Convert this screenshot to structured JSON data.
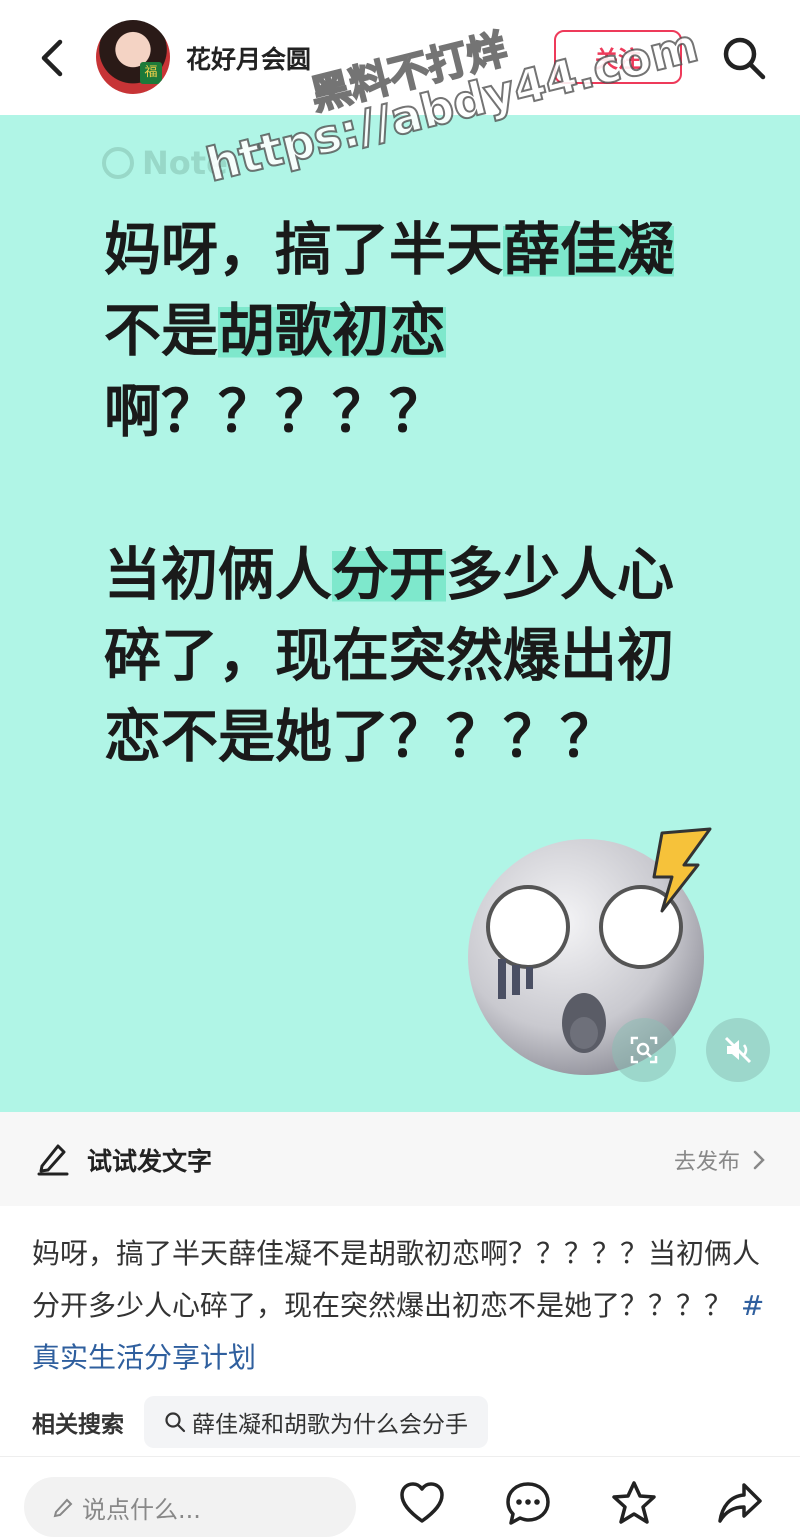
{
  "header": {
    "username": "花好月会圆",
    "follow_label": "关注"
  },
  "watermark": {
    "line1": "黑料不打烊",
    "line2": "https://abdy44.com"
  },
  "card": {
    "logo_text": "Note",
    "headline1": {
      "before": "妈呀，搞了半天",
      "hl1": "薛佳凝",
      "middle": "不是",
      "hl2": "胡歌初恋",
      "after": "啊？？？？？"
    },
    "headline2": {
      "before": "当初俩人",
      "hl": "分开",
      "after": "多少人心碎了，现在突然爆出初恋不是她了？？？？"
    },
    "background_color": "#b0f5e6",
    "highlight_color": "#7ee8cc"
  },
  "try_bar": {
    "label": "试试发文字",
    "publish_label": "去发布"
  },
  "post": {
    "text": "妈呀，搞了半天薛佳凝不是胡歌初恋啊？？？？？当初俩人分开多少人心碎了，现在突然爆出初恋不是她了？？？？ ",
    "hashtag": "#真实生活分享计划"
  },
  "related": {
    "label": "相关搜索",
    "query": "薛佳凝和胡歌为什么会分手"
  },
  "bottom_bar": {
    "comment_placeholder": "说点什么..."
  },
  "icons": [
    "back-arrow-icon",
    "search-icon",
    "scan-icon",
    "mute-icon",
    "pen-icon",
    "chevron-right-icon",
    "heart-icon",
    "comment-bubble-icon",
    "star-icon",
    "share-arrow-icon"
  ],
  "colors": {
    "accent": "#ee3a5a",
    "hashtag": "#2f5f9e"
  }
}
